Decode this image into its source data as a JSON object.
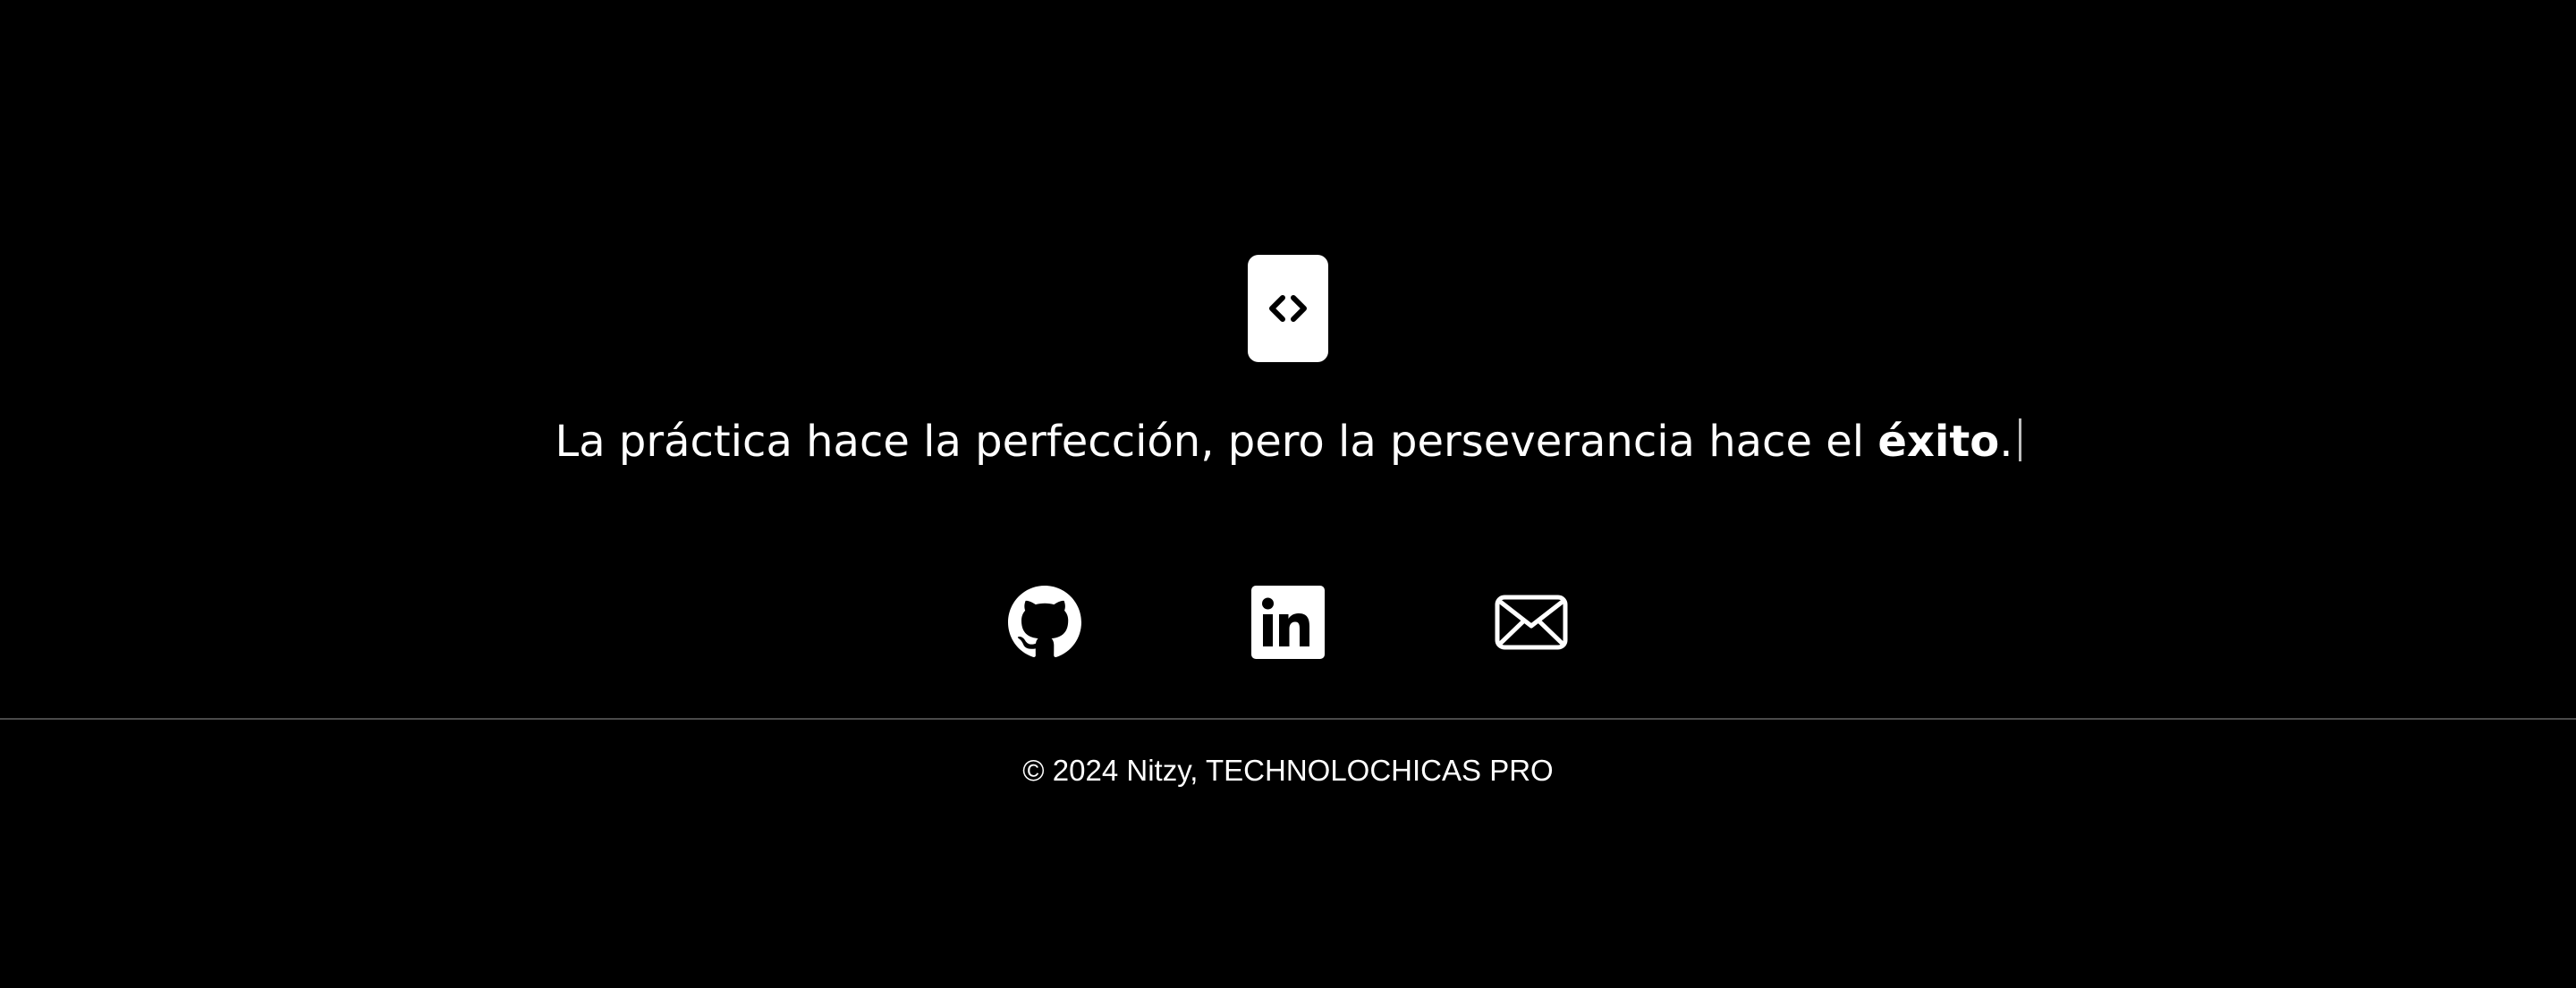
{
  "header": {
    "logo_icon": "code-brackets-icon"
  },
  "quote": {
    "text_before": "La práctica hace la perfección, pero la perseverancia hace el ",
    "emphasis": "éxito",
    "text_after": "."
  },
  "socials": [
    {
      "label": "GitHub",
      "icon": "github-icon"
    },
    {
      "label": "LinkedIn",
      "icon": "linkedin-icon"
    },
    {
      "label": "Email",
      "icon": "mail-icon"
    }
  ],
  "footer": {
    "copyright": "© 2024 Nitzy, TECHNOLOCHICAS PRO"
  },
  "colors": {
    "background": "#000000",
    "foreground": "#ffffff",
    "divider": "#4a4a4a"
  }
}
